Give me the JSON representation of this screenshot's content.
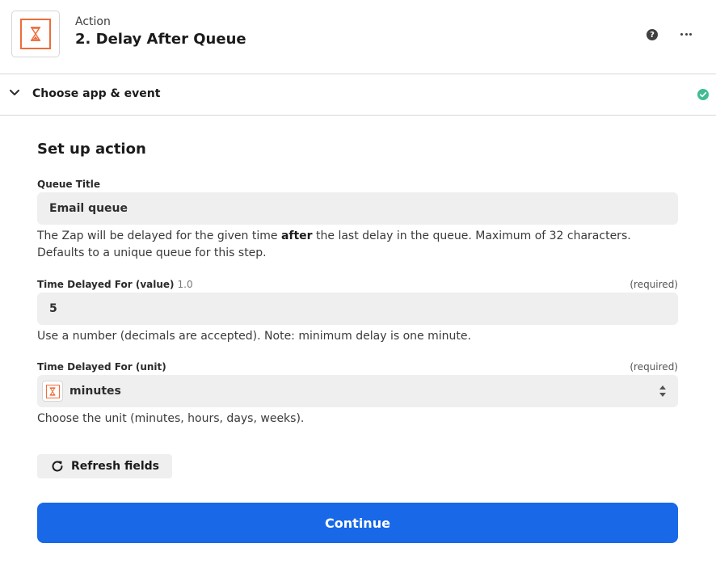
{
  "header": {
    "subtitle": "Action",
    "title": "2. Delay After Queue",
    "app_icon": "hourglass-icon",
    "help_icon": "question-icon",
    "more_icon": "more-horizontal-icon"
  },
  "section": {
    "label": "Choose app & event",
    "status": "complete",
    "status_color": "#3ebd93"
  },
  "form": {
    "title": "Set up action",
    "queue_title": {
      "label": "Queue Title",
      "value": "Email queue",
      "help_before": "The Zap will be delayed for the given time ",
      "help_bold": "after",
      "help_after": " the last delay in the queue. Maximum of 32 characters. Defaults to a unique queue for this step."
    },
    "delay_value": {
      "label": "Time Delayed For (value)",
      "meta": "1.0",
      "required": "(required)",
      "value": "5",
      "help": "Use a number (decimals are accepted). Note: minimum delay is one minute."
    },
    "delay_unit": {
      "label": "Time Delayed For (unit)",
      "required": "(required)",
      "value": "minutes",
      "help": "Choose the unit (minutes, hours, days, weeks)."
    },
    "refresh_label": "Refresh fields",
    "continue_label": "Continue"
  },
  "colors": {
    "accent": "#1868e8",
    "app_icon": "#ef6c3a",
    "success": "#3ebd93"
  }
}
